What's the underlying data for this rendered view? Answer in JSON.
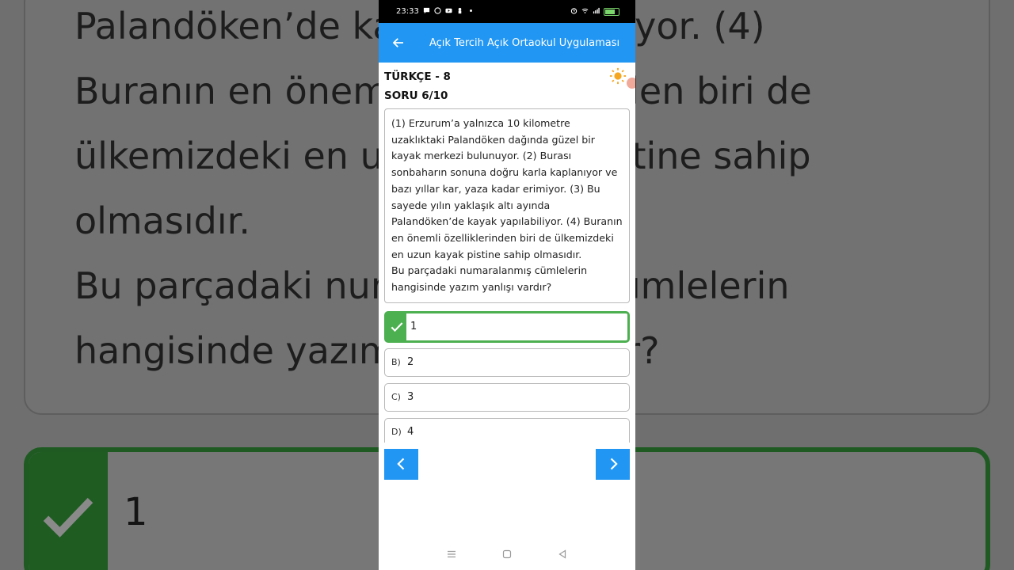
{
  "status_bar": {
    "time": "23:33",
    "icons": [
      "chat-icon",
      "whatsapp-icon",
      "youtube-icon",
      "lock-person-icon",
      "dot-icon",
      "alarm-icon",
      "wifi-icon",
      "signal-icon",
      "battery-icon"
    ]
  },
  "app_bar": {
    "title": "Açık Tercih Açık Ortaokul Uygulaması",
    "back_icon": "arrow-left-icon"
  },
  "quiz": {
    "subject": "TÜRKÇE - 8",
    "question_number": "SORU 6/10",
    "question_text": "(1) Erzurum’a yalnızca 10 kilometre uzaklıktaki Palandöken dağında güzel bir kayak merkezi bulunuyor. (2) Burası sonbaharın sonuna doğru karla kaplanıyor ve bazı yıllar kar, yaza kadar erimiyor. (3) Bu sayede yılın yaklaşık altı ayında Palandöken’de kayak yapılabiliyor. (4) Buranın en önemli özelliklerinden biri de ülkemizdeki en uzun kayak pistine sahip olmasıdır.\nBu parçadaki numaralanmış cümlelerin hangisinde yazım yanlışı vardır?",
    "options": [
      {
        "letter": "",
        "text": "1",
        "state": "correct"
      },
      {
        "letter": "B)",
        "text": "2",
        "state": "normal"
      },
      {
        "letter": "C)",
        "text": "3",
        "state": "normal"
      },
      {
        "letter": "D)",
        "text": "4",
        "state": "normal"
      }
    ]
  },
  "background": {
    "zoom_text": "Palandöken’de kayak yapılabiliyor. (4)\nBuranın en önemli özelliklerinden biri de\nülkemizdeki en uzun kayak pistine sahip\nolmasıdır.\nBu parçadaki numaralanmış cümlelerin\nhangisinde yazım yanlışı vardır?",
    "zoom_option": "1"
  },
  "colors": {
    "primary": "#2196f3",
    "correct": "#4caf50",
    "sun": "#f5a623"
  }
}
